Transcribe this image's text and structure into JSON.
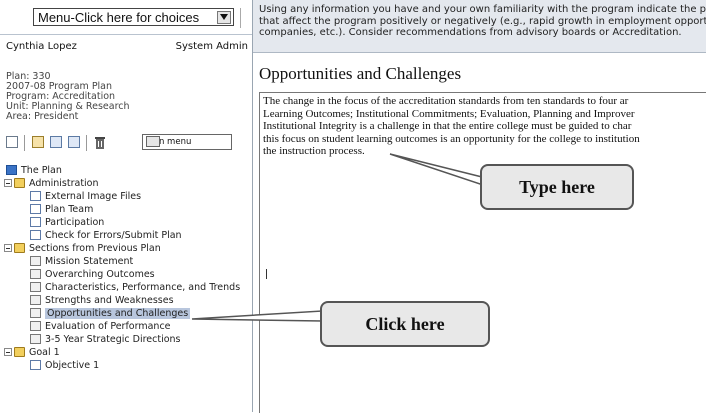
{
  "left": {
    "menu_button_label": "Menu-Click here for choices",
    "user_name": "Cynthia Lopez",
    "user_role": "System Admin",
    "plan_info": [
      "Plan: 330",
      "2007-08 Program Plan",
      "Program: Accreditation",
      "Unit: Planning & Research",
      "Area: President"
    ],
    "toolbar": {
      "plan_menu_label": "plan menu"
    },
    "tree": [
      {
        "label": "The Plan",
        "icon": "plan-icon"
      },
      {
        "label": "Administration",
        "icon": "folder-icon"
      },
      {
        "label": "External Image Files",
        "icon": "document-icon"
      },
      {
        "label": "Plan Team",
        "icon": "document-icon"
      },
      {
        "label": "Participation",
        "icon": "document-icon"
      },
      {
        "label": "Check for Errors/Submit Plan",
        "icon": "document-icon"
      },
      {
        "label": "Sections from Previous Plan",
        "icon": "folder-icon"
      },
      {
        "label": "Mission Statement",
        "icon": "page-icon"
      },
      {
        "label": "Overarching Outcomes",
        "icon": "page-icon"
      },
      {
        "label": "Characteristics, Performance, and Trends",
        "icon": "page-icon"
      },
      {
        "label": "Strengths and Weaknesses",
        "icon": "page-icon"
      },
      {
        "label": "Opportunities and Challenges",
        "icon": "page-icon",
        "selected": true
      },
      {
        "label": "Evaluation of Performance",
        "icon": "page-icon"
      },
      {
        "label": "3-5 Year Strategic Directions",
        "icon": "page-icon"
      },
      {
        "label": "Goal 1",
        "icon": "folder-icon"
      },
      {
        "label": "Objective 1",
        "icon": "document-icon"
      }
    ]
  },
  "right": {
    "instruction_lines": [
      "Using any information you have and your own familiarity with the program indicate the pr",
      "that affect the program positively or negatively (e.g., rapid growth in employment opport",
      "companies, etc.). Consider recommendations from advisory boards or Accreditation."
    ],
    "heading": "Opportunities and Challenges",
    "editor_lines": [
      "The change in the focus of the accreditation standards  from ten standards to four ar",
      "Learning Outcomes; Institutional Commitments; Evaluation, Planning and Improver",
      "Institutional Integrity is a challenge in that the entire college must be guided to char",
      "this focus on student learning outcomes is an opportunity for the college to institution",
      "the instruction process."
    ]
  },
  "callouts": {
    "type_here": "Type here",
    "click_here": "Click here"
  },
  "colors": {
    "instruction_bg": "#e4e8ee",
    "selected_bg": "#b8c6dd",
    "callout_bg": "#e8e8e8"
  }
}
